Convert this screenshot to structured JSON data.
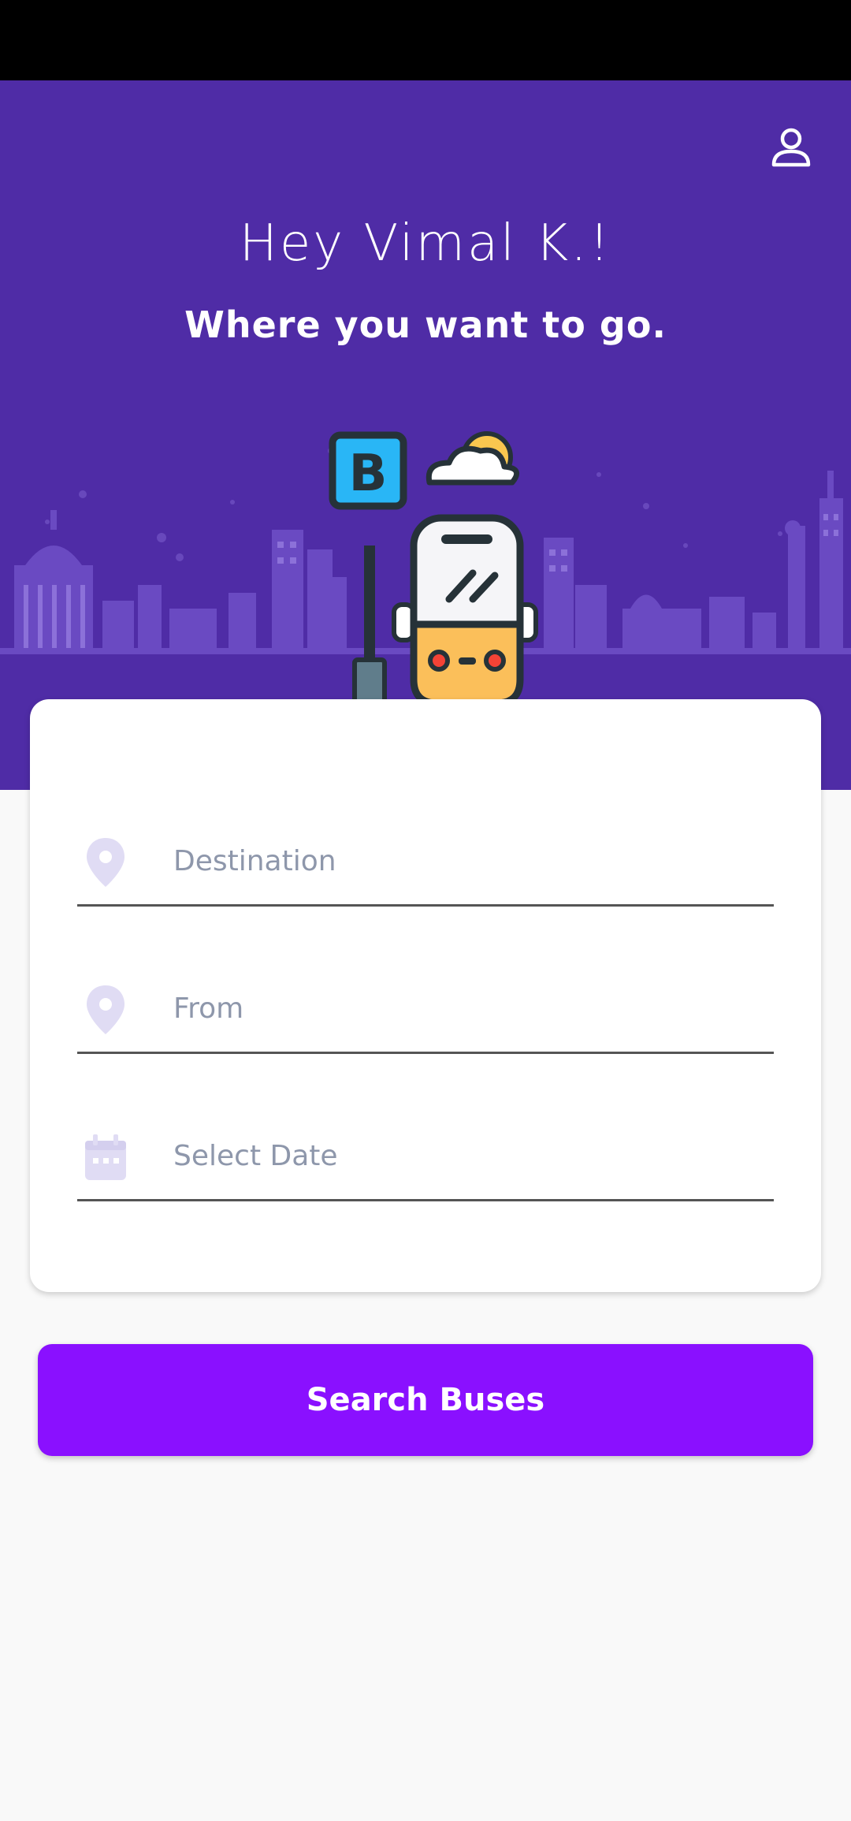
{
  "header": {
    "greeting": "Hey Vimal K.!",
    "subtitle": "Where you want to go.",
    "background_color": "#4f2ca6",
    "profile_icon": "user-icon",
    "illustration": "bus-stop-illustration",
    "bus_stop_sign_letter": "B"
  },
  "form": {
    "destination": {
      "placeholder": "Destination",
      "value": "",
      "icon": "location-pin-icon"
    },
    "from": {
      "placeholder": "From",
      "value": "",
      "icon": "location-pin-icon"
    },
    "date": {
      "placeholder": "Select Date",
      "value": "",
      "icon": "calendar-icon"
    }
  },
  "search_button": {
    "label": "Search Buses",
    "color": "#8a10ff"
  }
}
